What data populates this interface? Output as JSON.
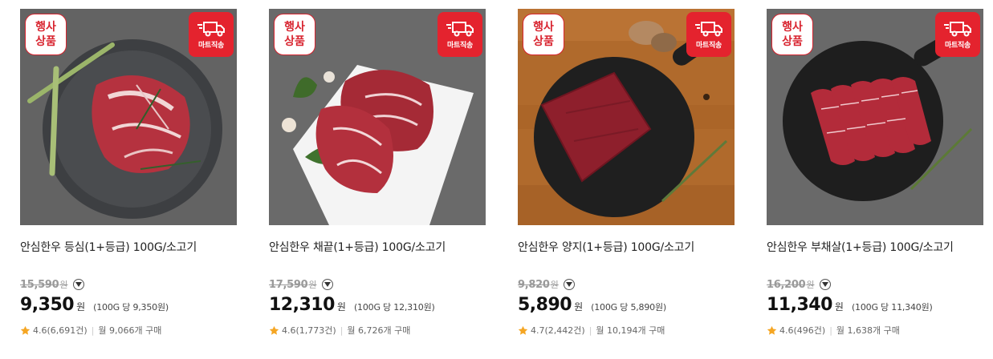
{
  "colors": {
    "accent": "#e4232e",
    "star": "#f5a623"
  },
  "products": [
    {
      "event_badge": "행사 상품",
      "delivery_badge": "마트직송",
      "title": "안심한우 등심(1+등급) 100G/소고기",
      "original_price": "15,590",
      "original_won": "원",
      "price": "9,350",
      "won": "원",
      "unit_price": "(100G 당 9,350원)",
      "rating": "4.6",
      "review_count": "(6,691건)",
      "monthly_sales": "월 9,066개 구매"
    },
    {
      "event_badge": "행사 상품",
      "delivery_badge": "마트직송",
      "title": "안심한우 채끝(1+등급) 100G/소고기",
      "original_price": "17,590",
      "original_won": "원",
      "price": "12,310",
      "won": "원",
      "unit_price": "(100G 당 12,310원)",
      "rating": "4.6",
      "review_count": "(1,773건)",
      "monthly_sales": "월 6,726개 구매"
    },
    {
      "event_badge": "행사 상품",
      "delivery_badge": "마트직송",
      "title": "안심한우 양지(1+등급) 100G/소고기",
      "original_price": "9,820",
      "original_won": "원",
      "price": "5,890",
      "won": "원",
      "unit_price": "(100G 당 5,890원)",
      "rating": "4.7",
      "review_count": "(2,442건)",
      "monthly_sales": "월 10,194개 구매"
    },
    {
      "event_badge": "행사 상품",
      "delivery_badge": "마트직송",
      "title": "안심한우 부채살(1+등급) 100G/소고기",
      "original_price": "16,200",
      "original_won": "원",
      "price": "11,340",
      "won": "원",
      "unit_price": "(100G 당 11,340원)",
      "rating": "4.6",
      "review_count": "(496건)",
      "monthly_sales": "월 1,638개 구매"
    }
  ]
}
